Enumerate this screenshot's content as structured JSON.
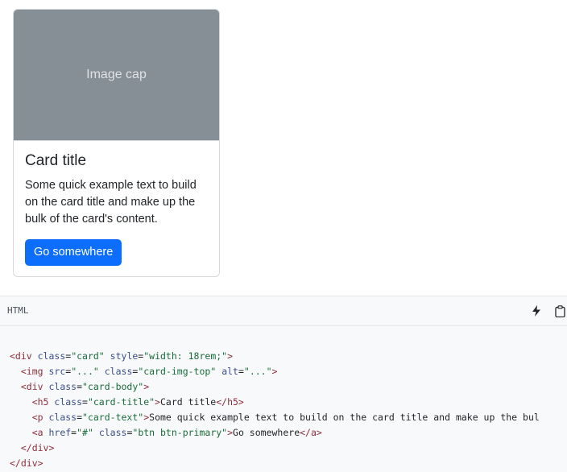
{
  "card": {
    "image_cap": "Image cap",
    "title": "Card title",
    "text": "Some quick example text to build on the card title and make up the bulk of the card's content.",
    "button_label": "Go somewhere"
  },
  "code": {
    "language": "HTML",
    "lines": [
      [
        "<div ",
        "class",
        "=",
        "\"card\"",
        " ",
        "style",
        "=",
        "\"width: 18rem;\"",
        ">"
      ],
      [
        "  <img ",
        "src",
        "=",
        "\"...\"",
        " ",
        "class",
        "=",
        "\"card-img-top\"",
        " ",
        "alt",
        "=",
        "\"...\"",
        ">"
      ],
      [
        "  <div ",
        "class",
        "=",
        "\"card-body\"",
        ">"
      ],
      [
        "    <h5 ",
        "class",
        "=",
        "\"card-title\"",
        ">",
        "Card title",
        "</h5>"
      ],
      [
        "    <p ",
        "class",
        "=",
        "\"card-text\"",
        ">",
        "Some quick example text to build on the card title and make up the bul"
      ],
      [
        "    <a ",
        "href",
        "=",
        "\"#\"",
        " ",
        "class",
        "=",
        "\"btn btn-primary\"",
        ">",
        "Go somewhere",
        "</a>"
      ],
      [
        "  </div>"
      ],
      [
        "</div>"
      ]
    ]
  },
  "icons": {
    "copy_to_playground": "lightning-bolt-icon",
    "copy_to_clipboard": "clipboard-icon"
  }
}
